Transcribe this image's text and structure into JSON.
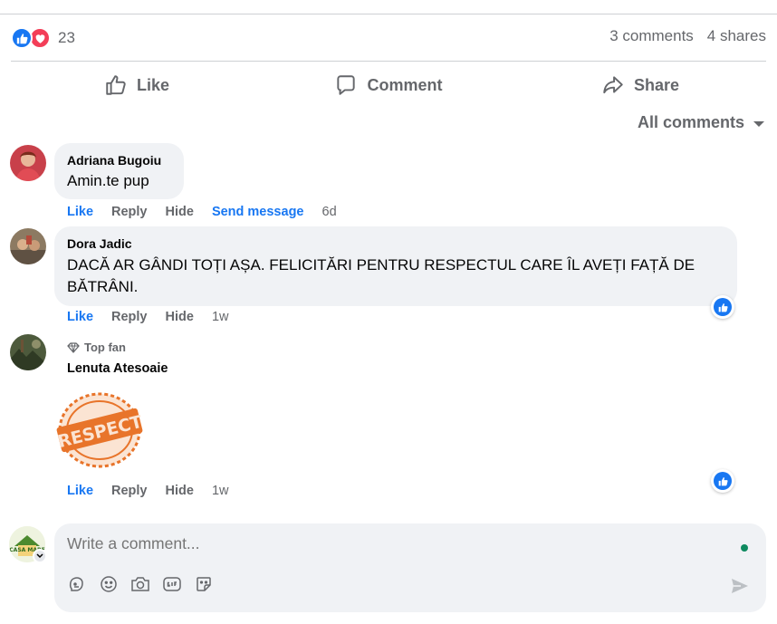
{
  "post": {
    "reaction_count": "23",
    "comments_count": "3 comments",
    "shares_count": "4 shares"
  },
  "actions": {
    "like": "Like",
    "comment": "Comment",
    "share": "Share"
  },
  "filter": {
    "label": "All comments"
  },
  "comments": [
    {
      "author": "Adriana Bugoiu",
      "text": "Amin.te pup",
      "like": "Like",
      "reply": "Reply",
      "hide": "Hide",
      "send_message": "Send message",
      "time": "6d"
    },
    {
      "author": "Dora Jadic",
      "text": "DACĂ AR GÂNDI TOȚI AȘA. FELICITĂRI PENTRU RESPECTUL CARE ÎL AVEȚI FAȚĂ DE BĂTRÂNI.",
      "like": "Like",
      "reply": "Reply",
      "hide": "Hide",
      "time": "1w"
    },
    {
      "badge": "Top fan",
      "author": "Lenuta Atesoaie",
      "sticker_text": "RESPECT",
      "like": "Like",
      "reply": "Reply",
      "hide": "Hide",
      "time": "1w"
    }
  ],
  "composer": {
    "placeholder": "Write a comment..."
  },
  "current_user": {
    "avatar_text": "CASA MARE"
  },
  "colors": {
    "accent": "#1877f2",
    "love": "#f33e58",
    "muted": "#65676b",
    "bubble": "#f0f2f5",
    "sticker": "#e8742a"
  }
}
